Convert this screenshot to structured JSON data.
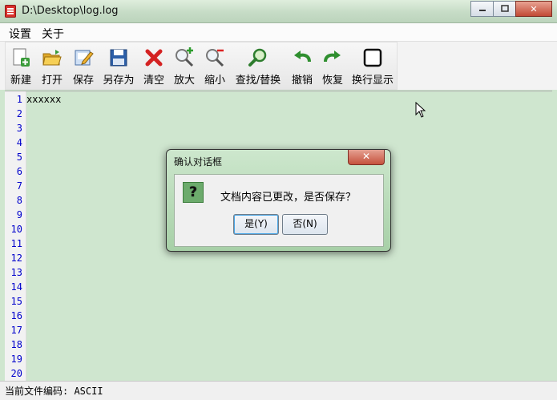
{
  "window": {
    "title": "D:\\Desktop\\log.log",
    "min": "▭",
    "max": "□",
    "close": "✕"
  },
  "menu": [
    "设置",
    "关于"
  ],
  "toolbar": [
    {
      "label": "新建",
      "icon": "new-file-icon"
    },
    {
      "label": "打开",
      "icon": "open-folder-icon"
    },
    {
      "label": "保存",
      "icon": "save-edit-icon"
    },
    {
      "label": "另存为",
      "icon": "save-as-floppy-icon"
    },
    {
      "label": "清空",
      "icon": "clear-x-icon"
    },
    {
      "label": "放大",
      "icon": "zoom-in-icon"
    },
    {
      "label": "缩小",
      "icon": "zoom-out-icon"
    },
    {
      "label": "查找/替换",
      "icon": "find-replace-icon"
    },
    {
      "label": "撤销",
      "icon": "undo-icon"
    },
    {
      "label": "恢复",
      "icon": "redo-icon"
    },
    {
      "label": "换行显示",
      "icon": "wrap-checkbox-icon"
    }
  ],
  "editor": {
    "line_numbers": [
      "1",
      "2",
      "3",
      "4",
      "5",
      "6",
      "7",
      "8",
      "9",
      "10",
      "11",
      "12",
      "13",
      "14",
      "15",
      "16",
      "17",
      "18",
      "19",
      "20"
    ],
    "content": "xxxxxx"
  },
  "status": {
    "text": "当前文件编码: ASCII"
  },
  "dialog": {
    "title": "确认对话框",
    "message": "文档内容已更改，是否保存？",
    "yes": "是(Y)",
    "no": "否(N)",
    "close": "✕",
    "icon_glyph": "?"
  },
  "colors": {
    "accent": "#cfe6cf",
    "line_numbers": "#0000cc"
  }
}
